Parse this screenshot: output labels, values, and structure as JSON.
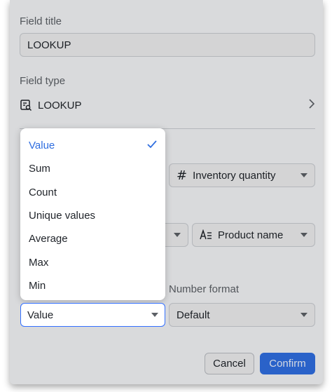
{
  "field_title": {
    "label": "Field title",
    "value": "LOOKUP"
  },
  "field_type": {
    "label": "Field type",
    "value": "LOOKUP",
    "icon": "lookup-icon"
  },
  "lookup_field": {
    "value": "Inventory quantity",
    "icon": "hash-icon"
  },
  "condition_field": {
    "value": "Product name",
    "icon": "text-field-icon"
  },
  "aggregation": {
    "selected": "Value",
    "options": [
      "Value",
      "Sum",
      "Count",
      "Unique values",
      "Average",
      "Max",
      "Min"
    ]
  },
  "number_format": {
    "label": "Number format",
    "value": "Default"
  },
  "buttons": {
    "cancel": "Cancel",
    "confirm": "Confirm"
  },
  "colors": {
    "accent": "#2f6ee0",
    "background": "#f2f3f5"
  }
}
